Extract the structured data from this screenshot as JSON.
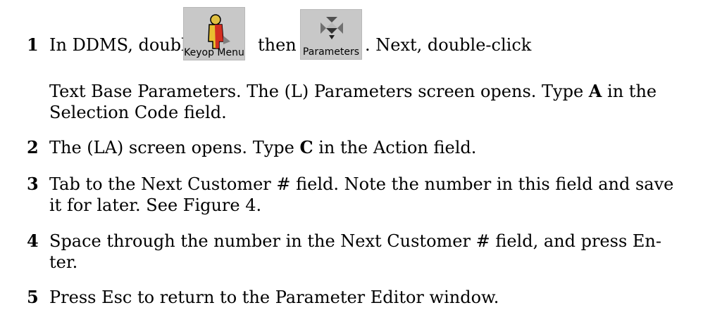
{
  "steps": [
    {
      "number": "1",
      "pre": "In DDMS, double-click",
      "mid": "then",
      "post": ". Next, double-click",
      "cont_a": "Text Base Parameters. The (L) Parameters screen opens. Type ",
      "cont_bold": "A",
      "cont_b": " in the",
      "cont_c": "Selection Code field."
    },
    {
      "number": "2",
      "pre": "The (LA) screen opens. Type ",
      "bold": "C",
      "post": " in the Action field."
    },
    {
      "number": "3",
      "line1": "Tab to the Next Customer # field. Note the number in this field and save",
      "line2": "it for later. See Figure 4."
    },
    {
      "number": "4",
      "line1": "Space through the number in the Next Customer # field, and press En-",
      "line2": "ter."
    },
    {
      "number": "5",
      "line1": "Press Esc to return to the Parameter Editor window."
    }
  ],
  "icons": {
    "keyop": {
      "name": "keyop-menu-icon",
      "caption": "Keyop Menu"
    },
    "params": {
      "name": "parameters-icon",
      "caption": "Parameters"
    }
  }
}
